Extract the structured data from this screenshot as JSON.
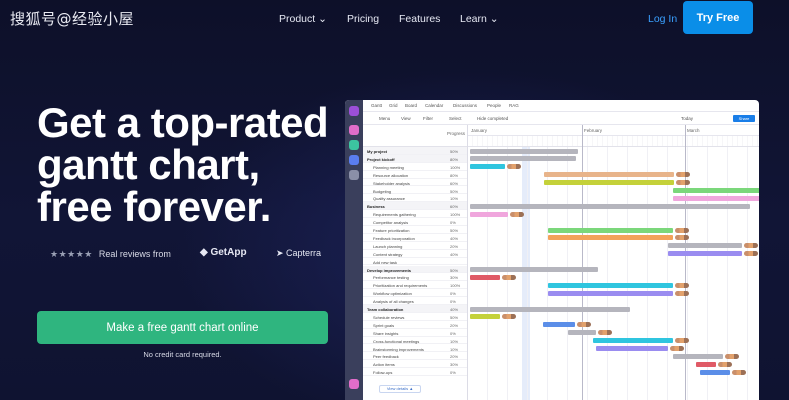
{
  "watermark": "搜狐号@经验小屋",
  "nav": {
    "items": [
      "Product ⌄",
      "Pricing",
      "Features",
      "Learn ⌄"
    ],
    "login": "Log In",
    "cta": "Try Free"
  },
  "hero": {
    "headline_lines": [
      "Get a top-rated",
      "gantt chart,",
      "free forever."
    ],
    "stars": "★★★★★",
    "reviews_text": "Real reviews from",
    "getapp": "GetApp",
    "capterra": "Capterra",
    "cta": "Make a free gantt chart online",
    "subnote": "No credit card required."
  },
  "app": {
    "toolbar": [
      "Gantt",
      "Grid",
      "Board",
      "Calendar",
      "Discussions",
      "People",
      "RAG"
    ],
    "toolbar2": [
      "Menu",
      "View",
      "Filter",
      "Select",
      "Hide completed"
    ],
    "toolbar2_right": [
      "Today",
      "Share"
    ],
    "grid_headers": [
      "Progress"
    ],
    "months": [
      "January",
      "February",
      "March"
    ],
    "views_label": "View details ▲",
    "rows": [
      {
        "name": "My project",
        "pct": "50%",
        "group": true
      },
      {
        "name": "Project kickoff",
        "pct": "80%",
        "group": true
      },
      {
        "name": "Planning meeting",
        "pct": "100%"
      },
      {
        "name": "Resource allocation",
        "pct": "80%"
      },
      {
        "name": "Stakeholder analysis",
        "pct": "60%"
      },
      {
        "name": "Budgeting",
        "pct": "50%"
      },
      {
        "name": "Quality assurance",
        "pct": "10%"
      },
      {
        "name": "Business",
        "pct": "60%",
        "group": true
      },
      {
        "name": "Requirements gathering",
        "pct": "100%"
      },
      {
        "name": "Competitor analysis",
        "pct": "0%"
      },
      {
        "name": "Feature prioritization",
        "pct": "50%"
      },
      {
        "name": "Feedback incorporation",
        "pct": "40%"
      },
      {
        "name": "Launch planning",
        "pct": "20%"
      },
      {
        "name": "Content strategy",
        "pct": "40%"
      },
      {
        "name": "Add new task",
        "pct": ""
      },
      {
        "name": "Develop improvements",
        "pct": "50%",
        "group": true
      },
      {
        "name": "Performance testing",
        "pct": "30%"
      },
      {
        "name": "Prioritization and requirements",
        "pct": "100%"
      },
      {
        "name": "Workflow optimization",
        "pct": "0%"
      },
      {
        "name": "Analysis of all changes",
        "pct": "0%"
      },
      {
        "name": "Team collaboration",
        "pct": "40%",
        "group": true
      },
      {
        "name": "Schedule reviews",
        "pct": "50%"
      },
      {
        "name": "Sprint goals",
        "pct": "20%"
      },
      {
        "name": "Share insights",
        "pct": "0%"
      },
      {
        "name": "Cross-functional meetings",
        "pct": "10%"
      },
      {
        "name": "Brainstorming improvements",
        "pct": "10%"
      },
      {
        "name": "Peer feedback",
        "pct": "20%"
      },
      {
        "name": "Action items",
        "pct": "30%"
      },
      {
        "name": "Follow-ups",
        "pct": "0%"
      }
    ],
    "colors": {
      "cyan": "#2fc5df",
      "tan": "#e8b48a",
      "olive": "#c4d13a",
      "green": "#7bd77b",
      "pink": "#f0a6dd",
      "orange": "#f3a25a",
      "red": "#e05a66",
      "purple": "#9a8cf0",
      "blue": "#5b8ee8",
      "gray": "#b5b5bd"
    }
  }
}
